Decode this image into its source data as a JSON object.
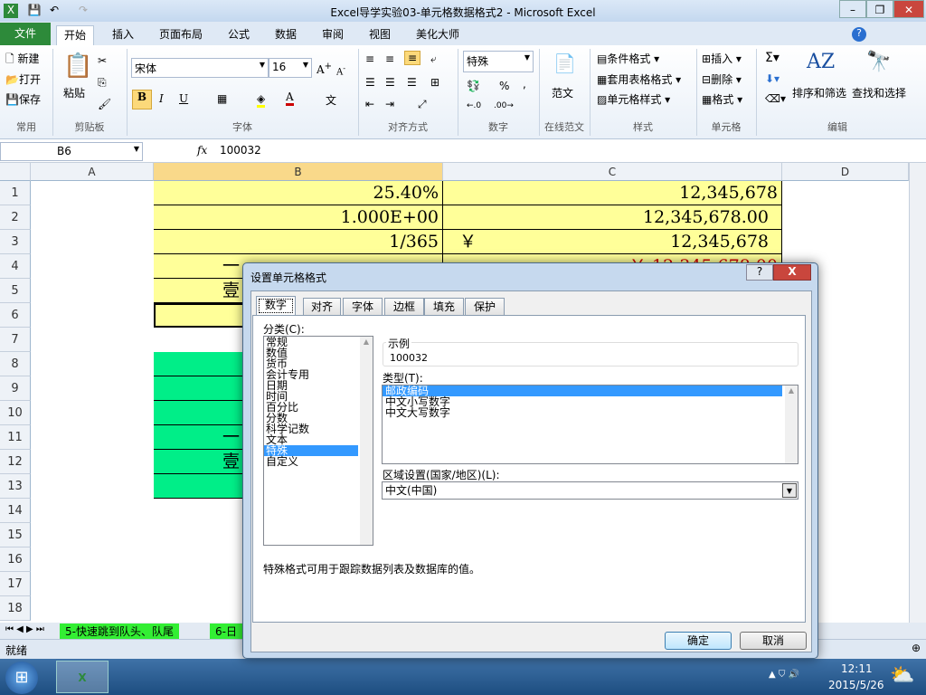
{
  "window": {
    "title": "Excel导学实验03-单元格数据格式2 - Microsoft Excel"
  },
  "ribbon_tabs": [
    "文件",
    "开始",
    "插入",
    "页面布局",
    "公式",
    "数据",
    "审阅",
    "视图",
    "美化大师"
  ],
  "ribbon": {
    "common": {
      "new": "新建",
      "open": "打开",
      "save": "保存",
      "group": "常用"
    },
    "clipboard": {
      "paste": "粘贴",
      "group": "剪贴板"
    },
    "font": {
      "name": "宋体",
      "size": "16",
      "group": "字体",
      "bold": "B",
      "italic": "I",
      "underline": "U"
    },
    "align": {
      "group": "对齐方式"
    },
    "number": {
      "format": "特殊",
      "percent": "%",
      "comma": ",",
      "group": "数字"
    },
    "template": {
      "label": "范文",
      "group": "在线范文"
    },
    "styles": {
      "cond": "条件格式",
      "table": "套用表格格式",
      "cell": "单元格样式",
      "group": "样式"
    },
    "cells": {
      "insert": "插入",
      "delete": "删除",
      "format": "格式",
      "group": "单元格"
    },
    "edit": {
      "sort": "排序和筛选",
      "find": "查找和选择",
      "group": "编辑"
    }
  },
  "formula_bar": {
    "name_box": "B6",
    "fx": "fx",
    "value": "100032"
  },
  "columns": [
    "A",
    "B",
    "C",
    "D"
  ],
  "rows": [
    "1",
    "2",
    "3",
    "4",
    "5",
    "6",
    "7",
    "8",
    "9",
    "10",
    "11",
    "12",
    "13",
    "14",
    "15",
    "16",
    "17",
    "18"
  ],
  "cells": {
    "B1": "25.40%",
    "C1": "12,345,678",
    "B2": "1.000E+00",
    "C2": "12,345,678.00",
    "B3": "1/365",
    "C3_sym": "￥",
    "C3": "12,345,678",
    "B4": "一",
    "C4": "￥-12,345,678.00",
    "B5": "壹",
    "B11": "一",
    "B12": "壹"
  },
  "sheet_tabs": [
    "5-快速跳到队头、队尾",
    "6-日"
  ],
  "status": {
    "ready": "就绪"
  },
  "dialog": {
    "title": "设置单元格格式",
    "tabs": [
      "数字",
      "对齐",
      "字体",
      "边框",
      "填充",
      "保护"
    ],
    "category_label": "分类(C):",
    "categories": [
      "常规",
      "数值",
      "货币",
      "会计专用",
      "日期",
      "时间",
      "百分比",
      "分数",
      "科学记数",
      "文本",
      "特殊",
      "自定义"
    ],
    "selected_category": "特殊",
    "sample_label": "示例",
    "sample_value": "100032",
    "type_label": "类型(T):",
    "types": [
      "邮政编码",
      "中文小写数字",
      "中文大写数字"
    ],
    "locale_label": "区域设置(国家/地区)(L):",
    "locale_value": "中文(中国)",
    "description": "特殊格式可用于跟踪数据列表及数据库的值。",
    "ok": "确定",
    "cancel": "取消",
    "help": "?",
    "close": "X"
  },
  "taskbar": {
    "time": "12:11",
    "date": "2015/5/26"
  },
  "colors": {
    "yellow": "#ffff99",
    "green": "#00ee88",
    "selection": "#3399ff",
    "negative": "#d00000"
  }
}
